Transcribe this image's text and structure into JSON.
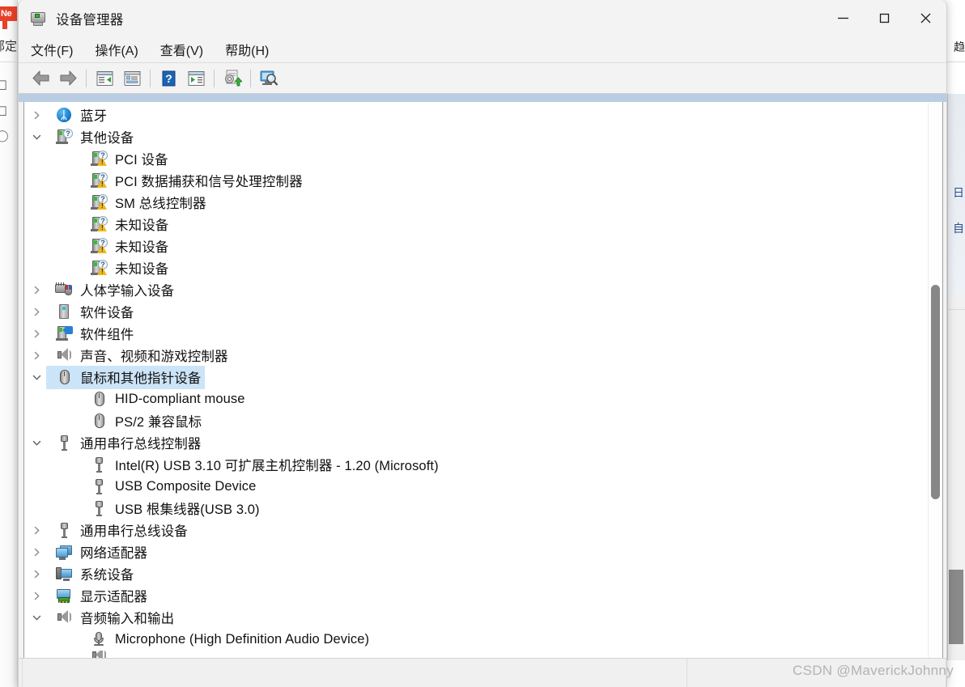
{
  "window": {
    "title": "设备管理器",
    "title_icon": "device-manager-icon",
    "controls": {
      "minimize": "minimize-icon",
      "maximize": "maximize-icon",
      "close": "close-icon"
    }
  },
  "menubar": {
    "items": [
      {
        "label": "文件(F)"
      },
      {
        "label": "操作(A)"
      },
      {
        "label": "查看(V)"
      },
      {
        "label": "帮助(H)"
      }
    ]
  },
  "toolbar": {
    "buttons": [
      {
        "name": "back-icon"
      },
      {
        "name": "forward-icon"
      },
      {
        "name": "show-hide-console-tree-icon"
      },
      {
        "name": "properties-icon"
      },
      {
        "name": "help-icon"
      },
      {
        "name": "scan-for-hardware-changes-icon"
      },
      {
        "name": "update-driver-icon"
      },
      {
        "name": "show-hidden-devices-icon"
      }
    ]
  },
  "tree": {
    "items": [
      {
        "label": "蓝牙",
        "level": 1,
        "expander": "collapsed",
        "icon": "bluetooth-icon",
        "selected": false
      },
      {
        "label": "其他设备",
        "level": 1,
        "expander": "expanded",
        "icon": "unknown-device-group-icon",
        "selected": false
      },
      {
        "label": "PCI 设备",
        "level": 2,
        "expander": "none",
        "icon": "unknown-device-warning-icon",
        "selected": false
      },
      {
        "label": "PCI 数据捕获和信号处理控制器",
        "level": 2,
        "expander": "none",
        "icon": "unknown-device-warning-icon",
        "selected": false
      },
      {
        "label": "SM 总线控制器",
        "level": 2,
        "expander": "none",
        "icon": "unknown-device-warning-icon",
        "selected": false
      },
      {
        "label": "未知设备",
        "level": 2,
        "expander": "none",
        "icon": "unknown-device-warning-icon",
        "selected": false
      },
      {
        "label": "未知设备",
        "level": 2,
        "expander": "none",
        "icon": "unknown-device-warning-icon",
        "selected": false
      },
      {
        "label": "未知设备",
        "level": 2,
        "expander": "none",
        "icon": "unknown-device-warning-icon",
        "selected": false
      },
      {
        "label": "人体学输入设备",
        "level": 1,
        "expander": "collapsed",
        "icon": "hid-keyboard-icon",
        "selected": false
      },
      {
        "label": "软件设备",
        "level": 1,
        "expander": "collapsed",
        "icon": "software-device-icon",
        "selected": false
      },
      {
        "label": "软件组件",
        "level": 1,
        "expander": "collapsed",
        "icon": "software-component-icon",
        "selected": false
      },
      {
        "label": "声音、视频和游戏控制器",
        "level": 1,
        "expander": "collapsed",
        "icon": "speaker-icon",
        "selected": false
      },
      {
        "label": "鼠标和其他指针设备",
        "level": 1,
        "expander": "expanded",
        "icon": "mouse-icon",
        "selected": true
      },
      {
        "label": "HID-compliant mouse",
        "level": 2,
        "expander": "none",
        "icon": "mouse-icon",
        "selected": false
      },
      {
        "label": "PS/2 兼容鼠标",
        "level": 2,
        "expander": "none",
        "icon": "mouse-icon",
        "selected": false
      },
      {
        "label": "通用串行总线控制器",
        "level": 1,
        "expander": "expanded",
        "icon": "usb-icon",
        "selected": false
      },
      {
        "label": "Intel(R) USB 3.10 可扩展主机控制器 - 1.20 (Microsoft)",
        "level": 2,
        "expander": "none",
        "icon": "usb-icon",
        "selected": false
      },
      {
        "label": "USB Composite Device",
        "level": 2,
        "expander": "none",
        "icon": "usb-icon",
        "selected": false
      },
      {
        "label": "USB 根集线器(USB 3.0)",
        "level": 2,
        "expander": "none",
        "icon": "usb-icon",
        "selected": false
      },
      {
        "label": "通用串行总线设备",
        "level": 1,
        "expander": "collapsed",
        "icon": "usb-icon",
        "selected": false
      },
      {
        "label": "网络适配器",
        "level": 1,
        "expander": "collapsed",
        "icon": "network-adapter-icon",
        "selected": false
      },
      {
        "label": "系统设备",
        "level": 1,
        "expander": "collapsed",
        "icon": "system-device-icon",
        "selected": false
      },
      {
        "label": "显示适配器",
        "level": 1,
        "expander": "collapsed",
        "icon": "display-adapter-icon",
        "selected": false
      },
      {
        "label": "音频输入和输出",
        "level": 1,
        "expander": "expanded",
        "icon": "speaker-icon",
        "selected": false
      },
      {
        "label": "Microphone (High Definition Audio Device)",
        "level": 2,
        "expander": "none",
        "icon": "microphone-icon",
        "selected": false
      }
    ]
  },
  "scrollbar": {
    "name": "vertical-scrollbar"
  },
  "statusbar": {
    "text": ""
  },
  "watermark": {
    "text": "CSDN @MaverickJohnny"
  },
  "background": {
    "left": {
      "badge": "Ne",
      "text": "部定",
      "icons": [
        "□",
        "□",
        "○"
      ]
    },
    "right": {
      "top_text": "趋",
      "texts": [
        "日",
        "自"
      ]
    }
  },
  "colors": {
    "selection": "#cce4f7",
    "blue_strip": "#b9cde3",
    "window_chrome": "#f3f3f3",
    "warning": "#f0b71c",
    "bluetooth": "#0a72c4",
    "badge_red": "#e8402a"
  }
}
